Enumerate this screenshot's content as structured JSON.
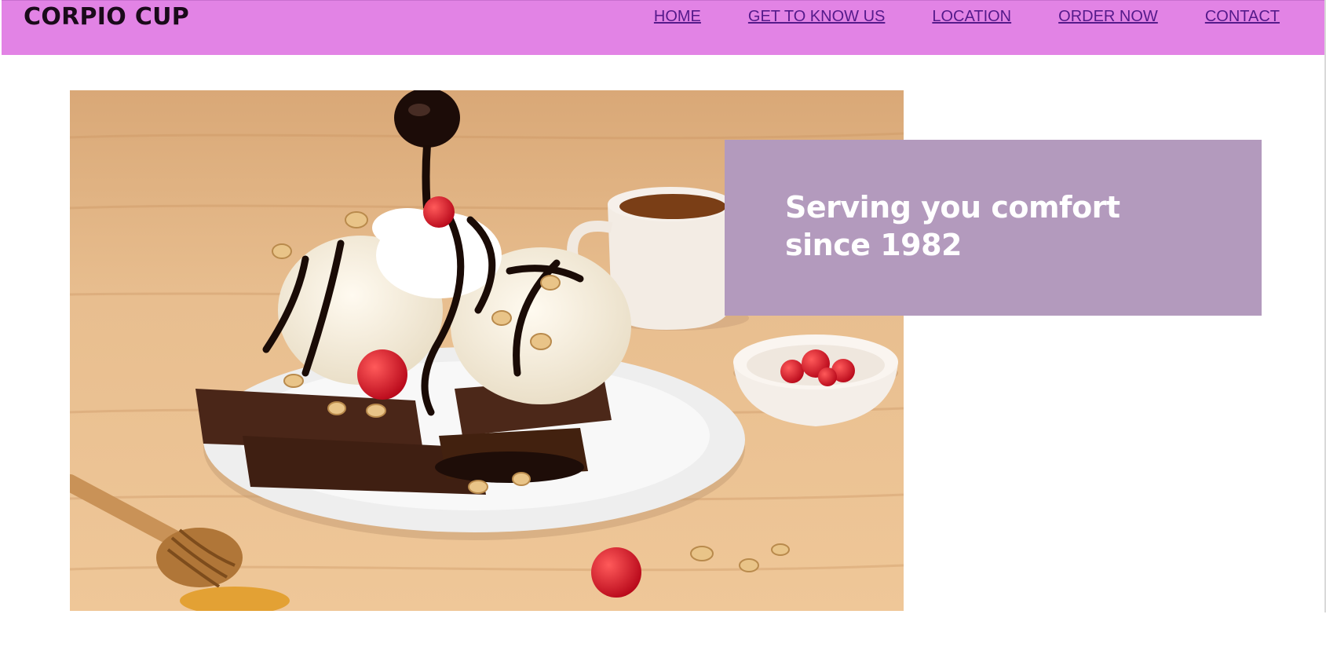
{
  "brand": {
    "name": "CORPIO CUP"
  },
  "nav": {
    "items": [
      {
        "label": "HOME"
      },
      {
        "label": "GET TO KNOW US"
      },
      {
        "label": "LOCATION"
      },
      {
        "label": "ORDER NOW"
      },
      {
        "label": "CONTACT"
      }
    ]
  },
  "hero": {
    "image_subject": "brownie-sundae-photo",
    "tagline": "Serving you comfort since 1982"
  },
  "colors": {
    "navbar_bg": "#e283e5",
    "nav_link": "#551a8b",
    "tagline_bg": "#b39abd",
    "tagline_text": "#ffffff"
  }
}
